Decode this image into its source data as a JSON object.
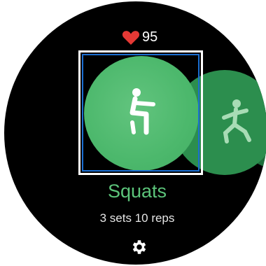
{
  "heart_rate": {
    "value": "95",
    "icon": "heart-icon",
    "color": "#e53935"
  },
  "exercise": {
    "name": "Squats",
    "detail": "3 sets 10 reps",
    "accent_color": "#5cc47a"
  },
  "carousel": {
    "selected": "Squats",
    "cards": [
      {
        "icon": "squat-figure-icon",
        "color": "#4cb86c"
      },
      {
        "icon": "lunge-figure-icon",
        "color": "#2c8e4e"
      },
      {
        "icon": "exercise-figure-icon",
        "color": "#1f6e3c"
      }
    ]
  },
  "settings": {
    "icon": "gear-icon"
  }
}
